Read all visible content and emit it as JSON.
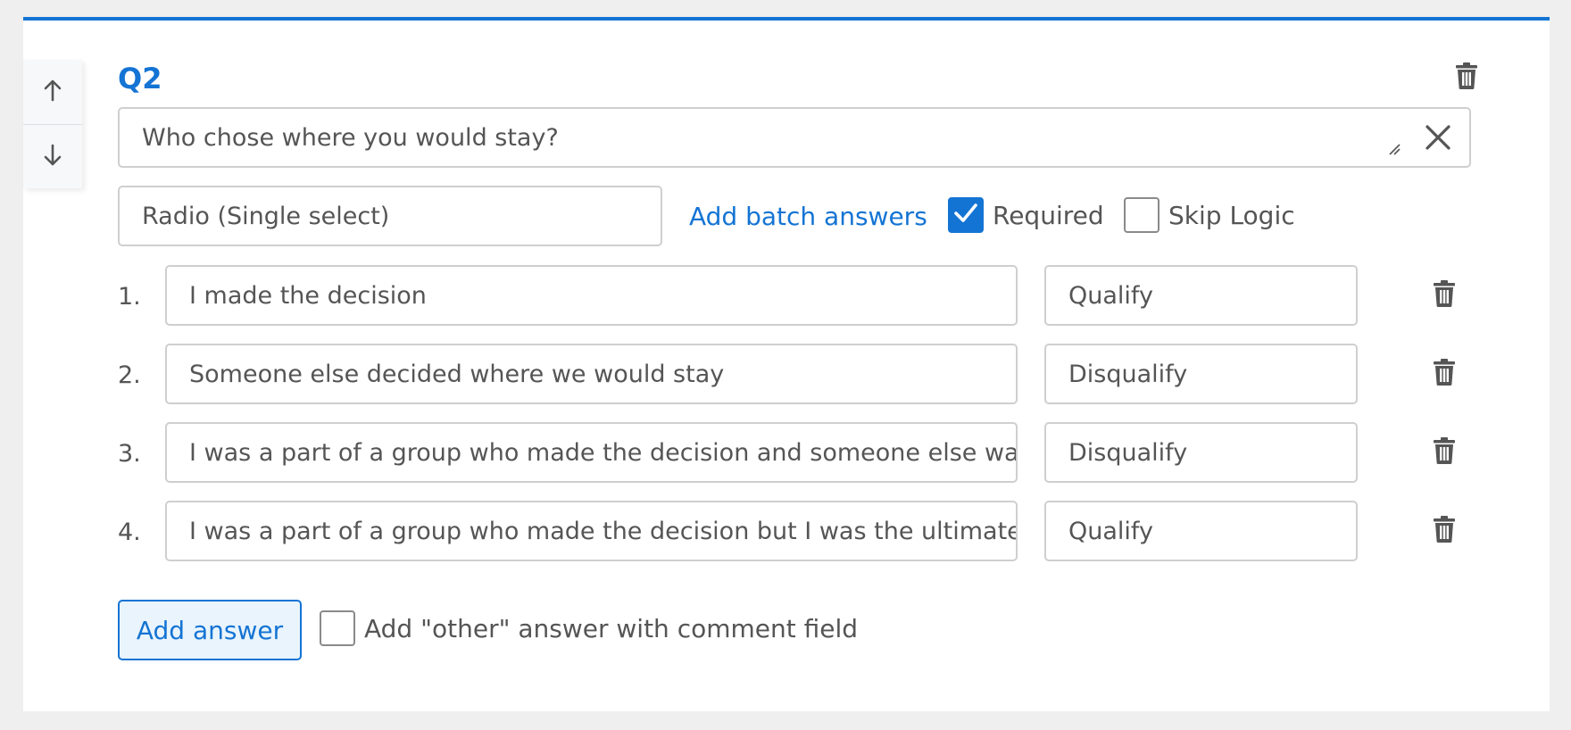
{
  "question": {
    "label": "Q2",
    "text": "Who chose where you would stay?",
    "type_value": "Radio (Single select)",
    "batch_link": "Add batch answers",
    "required_label": "Required",
    "required_checked": true,
    "skip_logic_label": "Skip Logic",
    "skip_logic_checked": false
  },
  "answers": [
    {
      "number": "1.",
      "text": "I made the decision",
      "outcome": "Qualify"
    },
    {
      "number": "2.",
      "text": "Someone else decided where we would stay",
      "outcome": "Disqualify"
    },
    {
      "number": "3.",
      "text": "I was a part of a group who made the decision and someone else was",
      "outcome": "Disqualify"
    },
    {
      "number": "4.",
      "text": "I was a part of a group who made the decision but I was the ultimate d",
      "outcome": "Qualify"
    }
  ],
  "footer": {
    "add_answer_label": "Add answer",
    "other_label": "Add \"other\" answer with comment field",
    "other_checked": false
  },
  "icons": {
    "move_up": "arrow-up-icon",
    "move_down": "arrow-down-icon",
    "delete": "trash-icon",
    "clear": "close-icon",
    "check": "checkmark-icon"
  },
  "colors": {
    "accent": "#1474d4",
    "add_answer_bg": "#e9f4fc",
    "text": "#555555",
    "border": "#cfcfcf"
  }
}
